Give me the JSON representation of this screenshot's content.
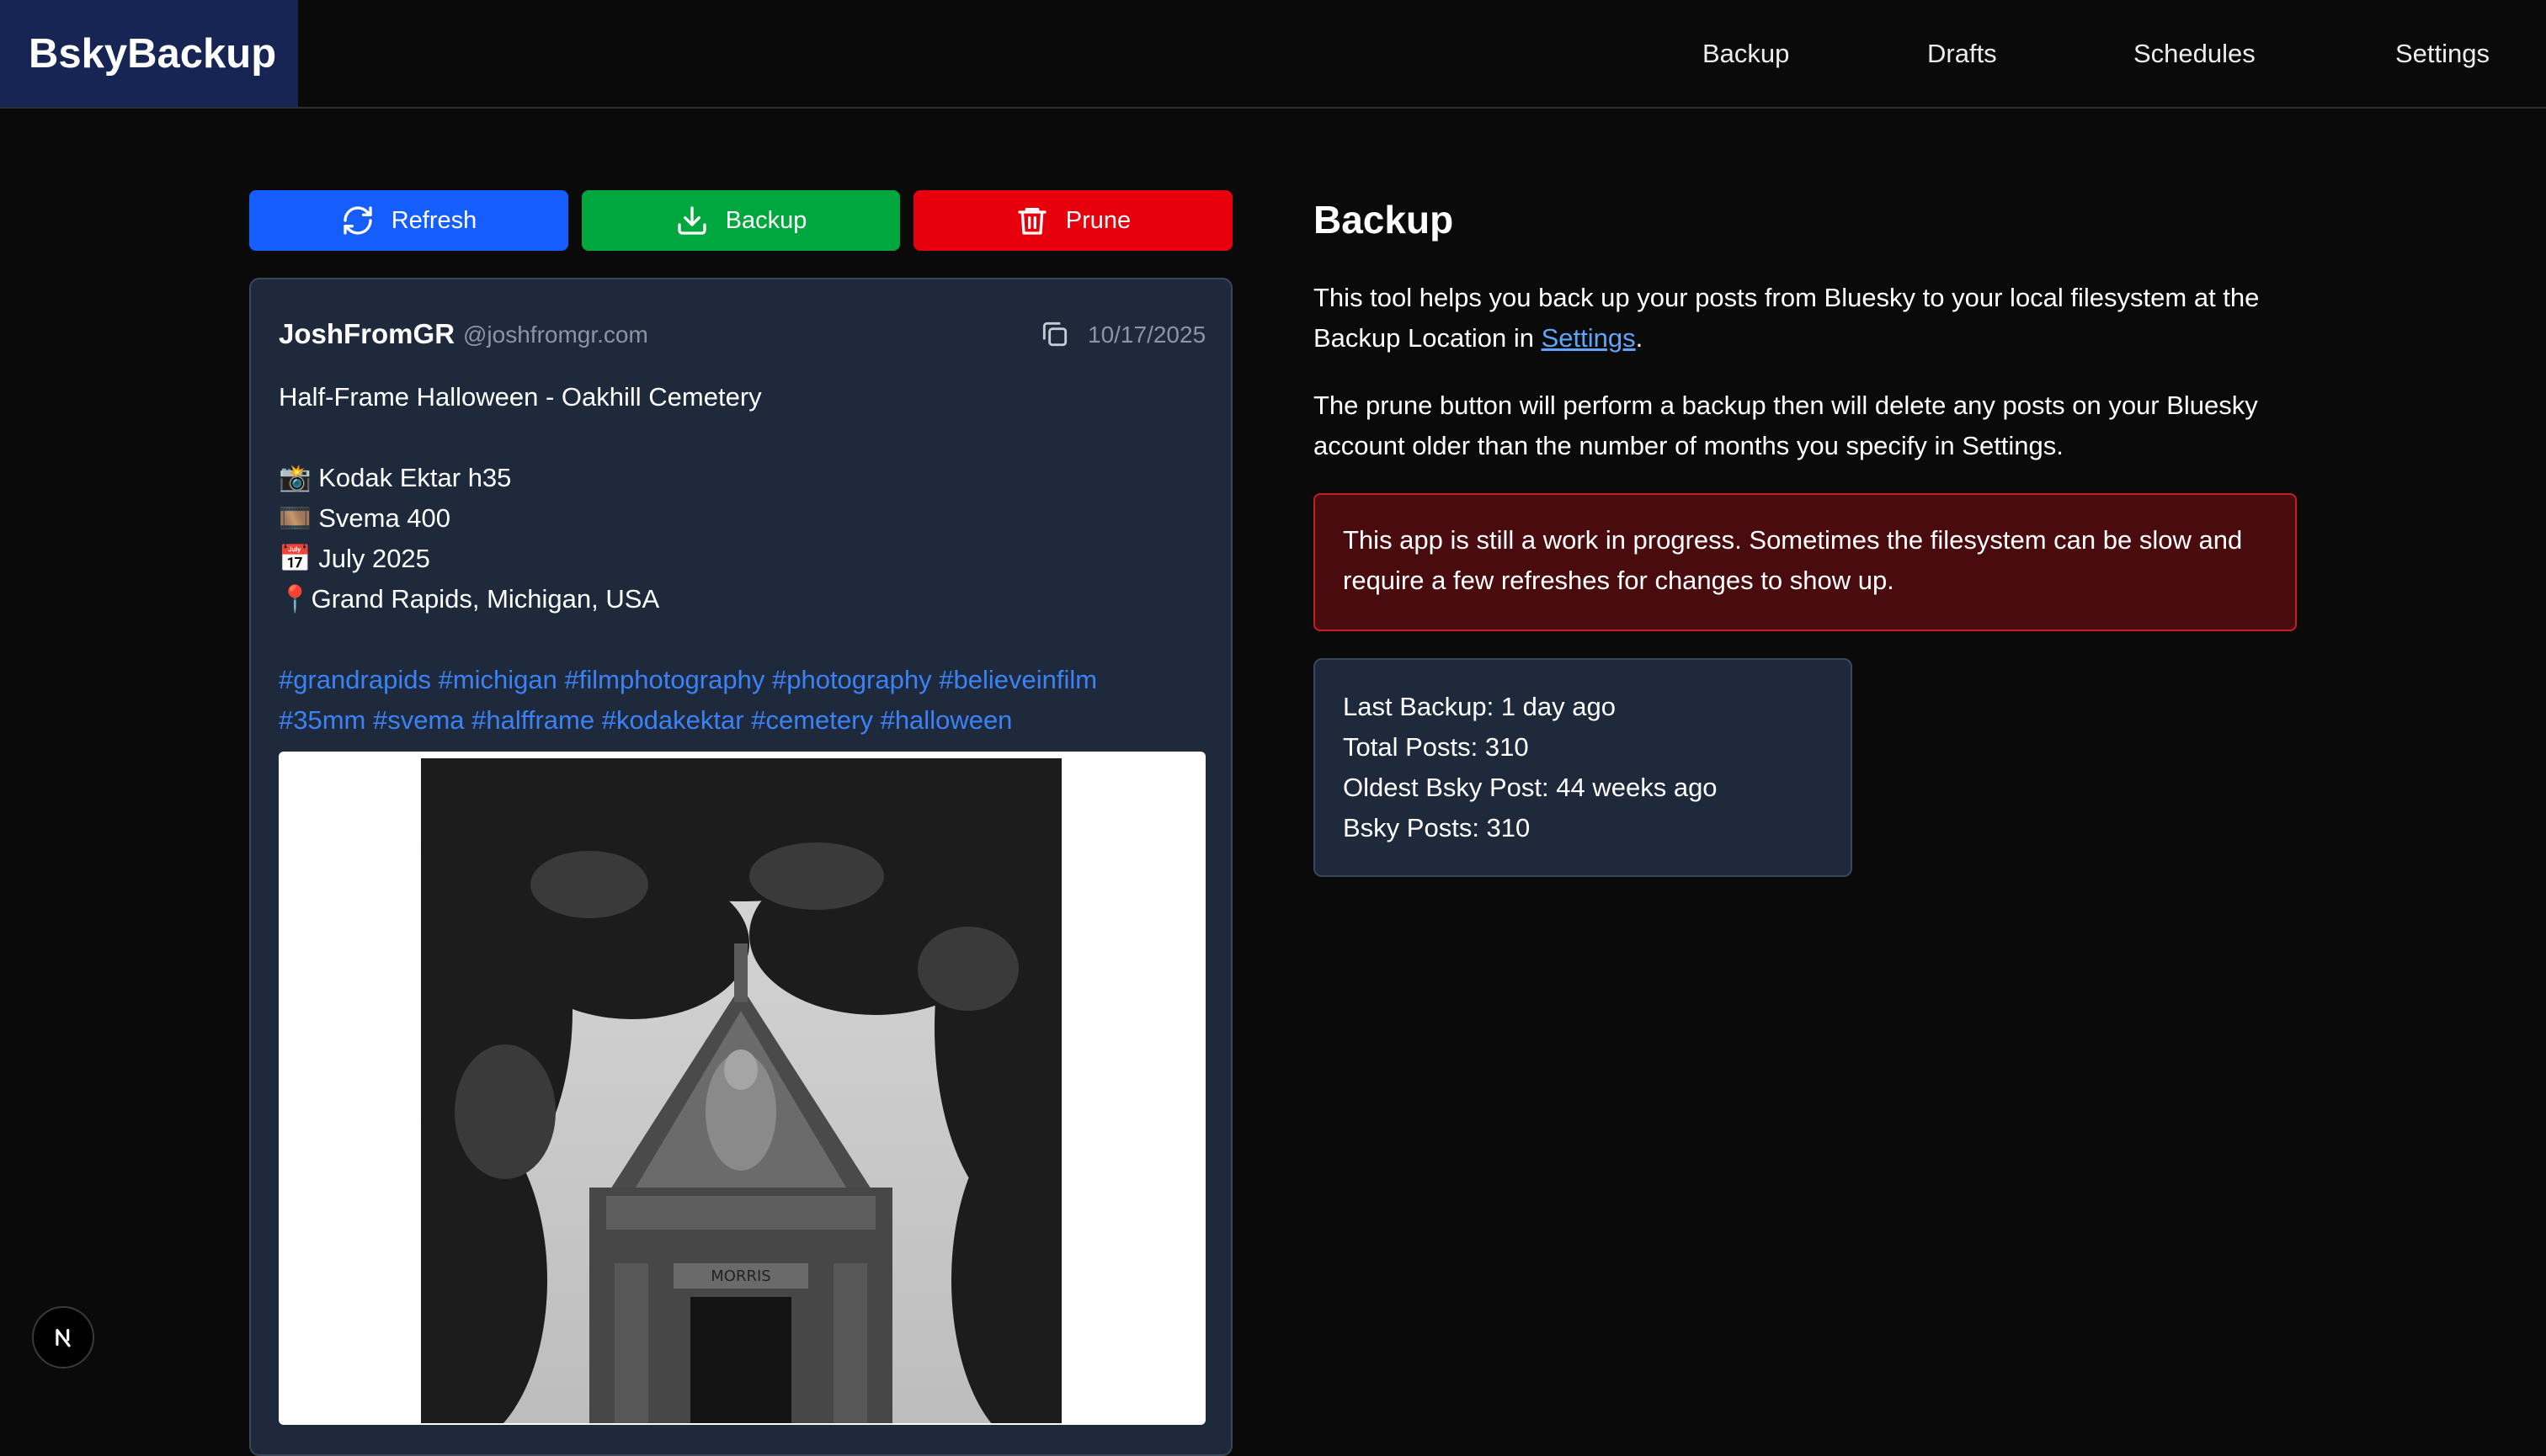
{
  "header": {
    "brand": "BskyBackup",
    "nav": [
      "Backup",
      "Drafts",
      "Schedules",
      "Settings"
    ]
  },
  "actions": {
    "refresh": {
      "label": "Refresh",
      "icon": "refresh-icon",
      "color": "#155dfc"
    },
    "backup": {
      "label": "Backup",
      "icon": "download-icon",
      "color": "#00a63e"
    },
    "prune": {
      "label": "Prune",
      "icon": "trash-icon",
      "color": "#e7000b"
    }
  },
  "post": {
    "author": "JoshFromGR",
    "handle": "@joshfromgr.com",
    "date": "10/17/2025",
    "lines": [
      "Half-Frame Halloween - Oakhill Cemetery",
      "",
      "📸 Kodak Ektar h35",
      "🎞️ Svema 400",
      "📅 July 2025",
      "📍Grand Rapids, Michigan, USA"
    ],
    "tags_line1": [
      "#grandrapids",
      "#michigan",
      "#filmphotography",
      "#photography",
      "#believeinfilm"
    ],
    "tags_line2": [
      "#35mm",
      "#svema",
      "#halfframe",
      "#kodakektar",
      "#cemetery",
      "#halloween"
    ],
    "image_plaque": "MORRIS"
  },
  "backup_panel": {
    "title": "Backup",
    "para1_a": "This tool helps you back up your posts from Bluesky to your local filesystem at the Backup Location in ",
    "para1_link": "Settings",
    "para1_b": ".",
    "para2": "The prune button will perform a backup then will delete any posts on your Bluesky account older than the number of months you specify in Settings.",
    "warning": "This app is still a work in progress. Sometimes the filesystem can be slow and require a few refreshes for changes to show up.",
    "stats": [
      "Last Backup: 1 day ago",
      "Total Posts: 310",
      "Oldest Bsky Post: 44 weeks ago",
      "Bsky Posts: 310"
    ]
  },
  "dev_badge": "N",
  "colors": {
    "brand_bg": "#172554",
    "card_bg": "#1e293b",
    "tag": "#3b82f6",
    "link": "#60a5fa",
    "warning_bg": "#4a0b0e",
    "warning_border": "#c81e1e"
  }
}
